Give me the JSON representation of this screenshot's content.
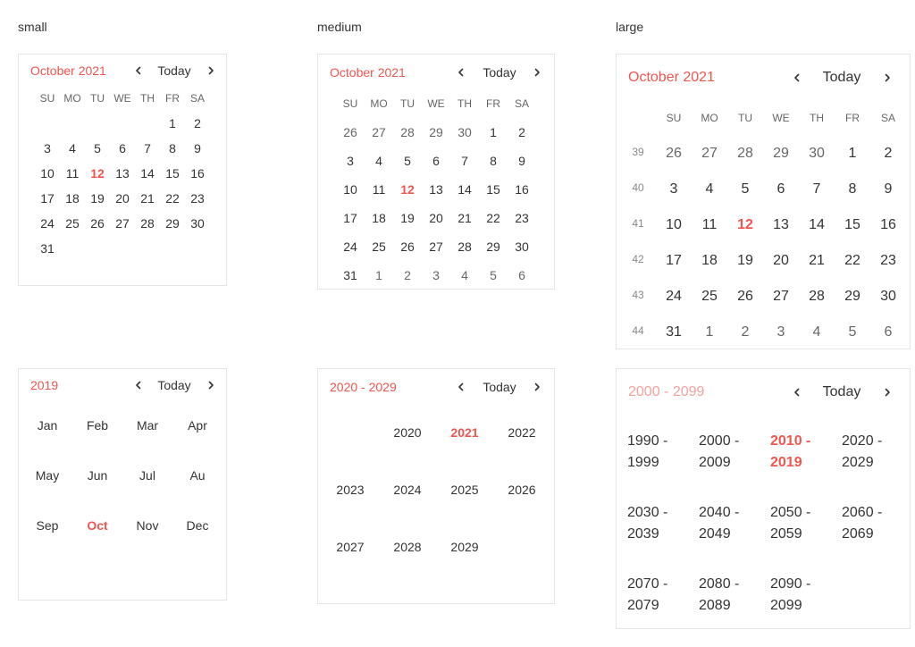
{
  "labels": {
    "small": "small",
    "medium": "medium",
    "large": "large"
  },
  "accent_color": "#f0564f",
  "icons": {
    "prev": "chevron-left-icon",
    "next": "chevron-right-icon"
  },
  "weekdays": [
    "SU",
    "MO",
    "TU",
    "WE",
    "TH",
    "FR",
    "SA"
  ],
  "today_label": "Today",
  "month_view": {
    "title": "October 2021",
    "selected_day": "12",
    "small_weeks": [
      [
        "",
        "",
        "",
        "",
        "",
        "1",
        "2"
      ],
      [
        "3",
        "4",
        "5",
        "6",
        "7",
        "8",
        "9"
      ],
      [
        "10",
        "11",
        "12",
        "13",
        "14",
        "15",
        "16"
      ],
      [
        "17",
        "18",
        "19",
        "20",
        "21",
        "22",
        "23"
      ],
      [
        "24",
        "25",
        "26",
        "27",
        "28",
        "29",
        "30"
      ],
      [
        "31",
        "",
        "",
        "",
        "",
        "",
        ""
      ]
    ],
    "full_weeks": [
      [
        "26",
        "27",
        "28",
        "29",
        "30",
        "1",
        "2"
      ],
      [
        "3",
        "4",
        "5",
        "6",
        "7",
        "8",
        "9"
      ],
      [
        "10",
        "11",
        "12",
        "13",
        "14",
        "15",
        "16"
      ],
      [
        "17",
        "18",
        "19",
        "20",
        "21",
        "22",
        "23"
      ],
      [
        "24",
        "25",
        "26",
        "27",
        "28",
        "29",
        "30"
      ],
      [
        "31",
        "1",
        "2",
        "3",
        "4",
        "5",
        "6"
      ]
    ],
    "full_weeks_other": [
      [
        true,
        true,
        true,
        true,
        true,
        false,
        false
      ],
      [
        false,
        false,
        false,
        false,
        false,
        false,
        false
      ],
      [
        false,
        false,
        false,
        false,
        false,
        false,
        false
      ],
      [
        false,
        false,
        false,
        false,
        false,
        false,
        false
      ],
      [
        false,
        false,
        false,
        false,
        false,
        false,
        false
      ],
      [
        false,
        true,
        true,
        true,
        true,
        true,
        true
      ]
    ],
    "week_numbers": [
      "39",
      "40",
      "41",
      "42",
      "43",
      "44"
    ]
  },
  "year_view": {
    "title": "2019",
    "selected": "Oct",
    "months": [
      "Jan",
      "Feb",
      "Mar",
      "Apr",
      "May",
      "Jun",
      "Jul",
      "Au",
      "Sep",
      "Oct",
      "Nov",
      "Dec"
    ]
  },
  "decade_view": {
    "title": "2020 - 2029",
    "selected": "2021",
    "years": [
      "",
      "2020",
      "2021",
      "2022",
      "2023",
      "2024",
      "2025",
      "2026",
      "2027",
      "2028",
      "2029",
      ""
    ]
  },
  "century_view": {
    "title": "2000 - 2099",
    "selected": "2010 - 2019",
    "decades": [
      "1990 - 1999",
      "2000 - 2009",
      "2010 - 2019",
      "2020 - 2029",
      "2030 - 2039",
      "2040 - 2049",
      "2050 - 2059",
      "2060 - 2069",
      "2070 - 2079",
      "2080 - 2089",
      "2090 - 2099",
      ""
    ]
  }
}
